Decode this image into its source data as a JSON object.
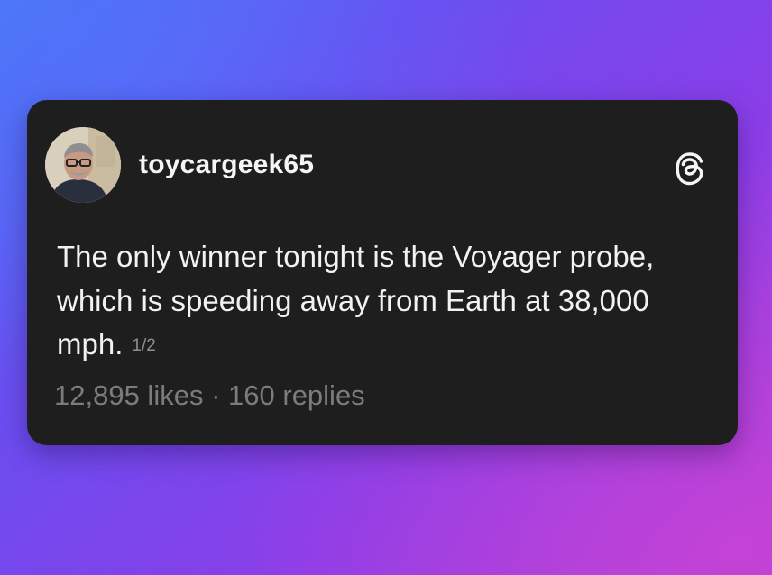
{
  "post": {
    "username": "toycargeek65",
    "text": "The only winner tonight is the Voyager probe, which is speeding away from Earth at 38,000 mph.",
    "thread_position": "1/2",
    "likes": "12,895 likes",
    "separator": "·",
    "replies": "160 replies",
    "logo_icon": "threads-logo-icon",
    "avatar_icon": "user-avatar-photo"
  },
  "colors": {
    "card_bg": "#1e1e1e",
    "text_primary": "#f2f2f2",
    "text_muted": "#7c7c7c",
    "background_gradient_start": "#4a76f4",
    "background_gradient_end": "#b63fd8"
  }
}
